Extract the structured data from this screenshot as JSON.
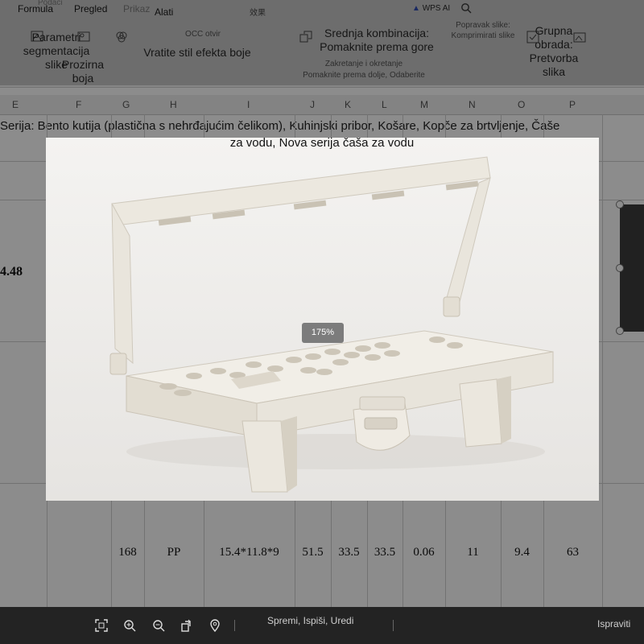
{
  "menubar": {
    "tabs": [
      "Formula",
      "Pregled",
      "Prikaz",
      "Alati"
    ],
    "ghost_label": "Podaci",
    "wps_ai": "WPS AI",
    "top_label": "效果"
  },
  "ribbon": {
    "b1": "Parametri segmentacija slike",
    "b2": "Prozirna boja",
    "b3": "Vratite stil efekta boje",
    "b4": "Srednja kombinacija: Pomaknite prema gore",
    "b4_sub1": "Zakretanje i okretanje",
    "b4_sub2": "Pomaknite prema dolje, Odaberite",
    "b5": "Popravak slike: Komprimirati slike",
    "b6": "Grupna obrada: Pretvorba slika",
    "ocr": "OCC otvir"
  },
  "sheet": {
    "columns": [
      "E",
      "F",
      "G",
      "H",
      "I",
      "J",
      "K",
      "L",
      "M",
      "N",
      "O",
      "P"
    ],
    "series_line": "Serija: Bento kutija (plastična s nehrđajućim čelikom), Kuhinjski pribor, Košare, Kopče za brtvljenje, Čaše",
    "left_value": "4.48",
    "row_values": [
      "168",
      "PP",
      "15.4*11.8*9",
      "51.5",
      "33.5",
      "33.5",
      "0.06",
      "11",
      "9.4",
      "63"
    ]
  },
  "viewer": {
    "caption": "za vodu, Nova serija čaša za vodu",
    "zoom": "175%",
    "zoom_level": 175
  },
  "toolbar": {
    "icons": [
      "fit-screen-icon",
      "zoom-in-icon",
      "zoom-out-icon",
      "rotate-icon",
      "location-pin-icon"
    ],
    "actions": "Spremi, Ispiši, Uredi",
    "right_label": "Ispraviti"
  },
  "colors": {
    "toolbar_bg": "#232323",
    "zoom_badge": "#7c7c7c",
    "product": "#e9e5dc"
  }
}
